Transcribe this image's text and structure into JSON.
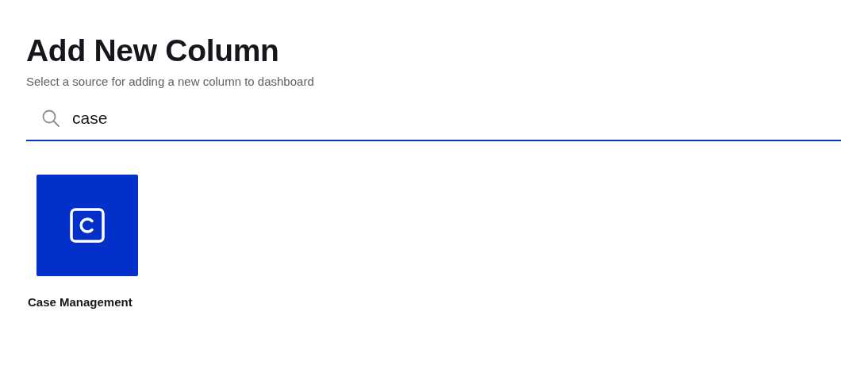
{
  "title": "Add New Column",
  "subtitle": "Select a source for adding a new column to dashboard",
  "search": {
    "value": "case"
  },
  "sources": [
    {
      "name": "Case Management",
      "kind": "case"
    }
  ]
}
